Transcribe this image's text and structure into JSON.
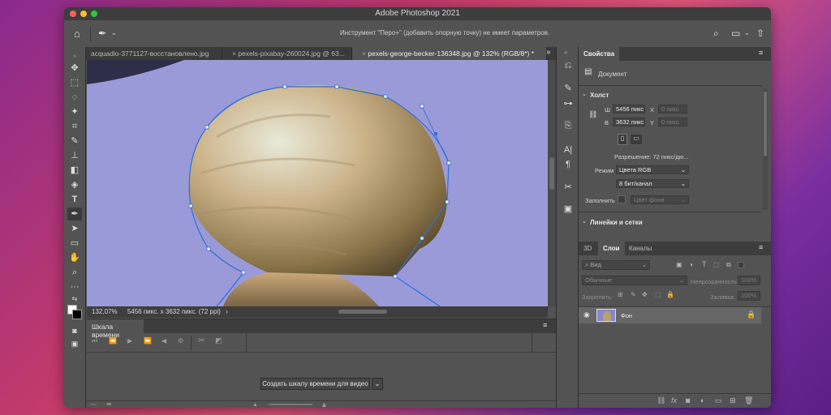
{
  "app": {
    "title": "Adobe Photoshop 2021"
  },
  "options_bar": {
    "hint": "Инструмент \"Перо+\" (добавить опорную точку) не имеет параметров."
  },
  "tabs": [
    {
      "label": "acquadio-3771127-восстановлено.jpg",
      "active": false
    },
    {
      "label": "pexels-pixabay-260024.jpg @ 63...",
      "active": false
    },
    {
      "label": "pexels-george-becker-136348.jpg @ 132% (RGB/8*) *",
      "active": true
    }
  ],
  "status": {
    "zoom": "132,07%",
    "info": "5456 пикс. x 3632 пикс. (72 ppi)",
    "arrow": "›"
  },
  "timeline": {
    "title": "Шкала времени",
    "create_button": "Создать шкалу времени для видео"
  },
  "properties": {
    "tab": "Свойства",
    "doc_label": "Документ",
    "canvas_section": "Холст",
    "w_label": "Ш",
    "w_value": "5456 пикс",
    "h_label": "В",
    "h_value": "3632 пикс",
    "x_label": "X",
    "x_placeholder": "0 пикс",
    "y_label": "Y",
    "y_placeholder": "0 пикс",
    "resolution": "Разрешение: 72 пикс/дю...",
    "mode_label": "Режим",
    "mode_value": "Цвета RGB",
    "depth_value": "8 бит/канал",
    "fill_label": "Заполнить",
    "fill_value": "Цвет фона",
    "rulers_section": "Линейки и сетки"
  },
  "layers_panel": {
    "tabs": [
      "3D",
      "Слои",
      "Каналы"
    ],
    "active_tab": "Слои",
    "kind_filter": "Вид",
    "blend_mode": "Обычные",
    "opacity_label": "Непрозрачность:",
    "opacity_value": "100%",
    "lock_label": "Закрепить:",
    "fill_label": "Заливка:",
    "fill_value": "100%",
    "layers": [
      {
        "name": "Фон",
        "visible": true,
        "locked": true
      }
    ]
  },
  "colors": {
    "canvas_bg": "#9a9ad8",
    "path": "#3b6fd0",
    "accent": "#2d6fd6"
  }
}
